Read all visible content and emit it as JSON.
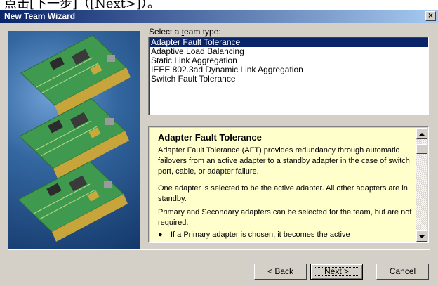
{
  "top_caption": "点击[下一步]（[Next>]）。",
  "window": {
    "title": "New Team Wizard",
    "close_symbol": "×"
  },
  "team_type": {
    "label_prefix": "Select a ",
    "label_accel": "t",
    "label_suffix": "eam type:",
    "options": [
      "Adapter Fault Tolerance",
      "Adaptive Load Balancing",
      "Static Link Aggregation",
      "IEEE 802.3ad Dynamic Link Aggregation",
      "Switch Fault Tolerance"
    ],
    "selected_index": 0
  },
  "description": {
    "title": "Adapter Fault Tolerance",
    "paragraphs": [
      "Adapter Fault Tolerance (AFT) provides redundancy through automatic failovers from an active adapter to a standby adapter in the case of switch port, cable, or adapter failure.",
      "One adapter is selected to be the active adapter. All other adapters are in standby.",
      "Primary and Secondary adapters can be selected for the team, but are not required."
    ],
    "bullet_marker": "●",
    "bullet_text": "If a Primary adapter is chosen, it becomes the active"
  },
  "buttons": {
    "back_prefix": "< ",
    "back_accel": "B",
    "back_suffix": "ack",
    "next_accel": "N",
    "next_suffix": "ext >",
    "cancel": "Cancel"
  },
  "colors": {
    "title_bar_start": "#0a246a",
    "title_bar_end": "#a6caf0",
    "selection": "#0a246a",
    "description_background": "#ffffcc",
    "dialog_face": "#d4d0c8",
    "art_background": "#33669f",
    "circuit_board": "#3f9a4f"
  }
}
